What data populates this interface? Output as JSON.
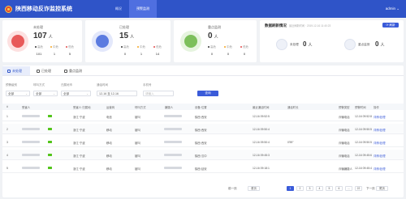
{
  "header": {
    "title": "陕西移动反诈监控系统",
    "tabs": [
      {
        "label": "概况"
      },
      {
        "label": "预警监测"
      }
    ],
    "user": "admin ⌄"
  },
  "stats": [
    {
      "label": "未处理",
      "value": "107",
      "unit": "人",
      "subs": [
        {
          "k": "高危",
          "v": "101",
          "color": "#333333"
        },
        {
          "k": "中危",
          "v": "1",
          "color": "#f5a623"
        },
        {
          "k": "低危",
          "v": "5",
          "color": "#e24c4c"
        }
      ]
    },
    {
      "label": "已处理",
      "value": "15",
      "unit": "人",
      "subs": [
        {
          "k": "高危",
          "v": "0",
          "color": "#333333"
        },
        {
          "k": "中危",
          "v": "1",
          "color": "#f5a623"
        },
        {
          "k": "低危",
          "v": "14",
          "color": "#e24c4c"
        }
      ]
    },
    {
      "label": "重点监测",
      "value": "0",
      "unit": "人",
      "subs": [
        {
          "k": "高危",
          "v": "0",
          "color": "#333333"
        },
        {
          "k": "中危",
          "v": "0",
          "color": "#f5a623"
        },
        {
          "k": "低危",
          "v": "0",
          "color": "#e24c4c"
        }
      ]
    }
  ],
  "panel": {
    "title": "数据刷新情况",
    "subtitle": "最近刷新时间 · 2019-12-16 11:40:23",
    "refresh": "刷新",
    "items": [
      {
        "label": "未处理",
        "value": "0",
        "unit": "人"
      },
      {
        "label": "重点监测",
        "value": "0",
        "unit": "人"
      }
    ]
  },
  "subtabs": [
    {
      "label": "未处理"
    },
    {
      "label": "已处理"
    },
    {
      "label": "重点监测"
    }
  ],
  "filters": {
    "labels": [
      "预警级别",
      "呼叫方式",
      "归属地市",
      "通话时间",
      "手机号"
    ],
    "values": [
      "全部",
      "全部",
      "全部",
      "12-16 至 12-16",
      ""
    ],
    "placeholder": "请输入",
    "search": "查询"
  },
  "table": {
    "headers": [
      "#",
      "受害人",
      "",
      "受害人·归属地",
      "运营商",
      "呼叫方式",
      "嫌疑人",
      "",
      "设备·位置",
      "最近通话时间",
      "通话时长",
      "",
      "预警类型",
      "预警时间",
      "操作"
    ],
    "rows": [
      [
        "1",
        "浙江·宁波",
        "电信",
        "被叫",
        "陕西·西安",
        "12-16 09:52:5",
        "",
        "诈骗电话",
        "12-16 09:52:8",
        "详情|处理"
      ],
      [
        "2",
        "浙江·宁波",
        "移动",
        "被叫",
        "陕西·西安",
        "12-16 09:50:4",
        "",
        "诈骗电话",
        "12-16 09:50:5",
        "详情|处理"
      ],
      [
        "3",
        "浙江·宁波",
        "移动",
        "被叫",
        "陕西·西安",
        "12-16 09:50:4",
        "0'59\"",
        "诈骗电话",
        "12-16 09:50:5",
        "详情|处理"
      ],
      [
        "4",
        "浙江·宁波",
        "移动",
        "被叫",
        "陕西·汉中",
        "12-16 09:45:3",
        "",
        "诈骗电话",
        "12-16 09:45:6",
        "详情|处理"
      ],
      [
        "5",
        "浙江·宁波",
        "移动",
        "被叫",
        "陕西·延安",
        "12-16 09:18:1",
        "",
        "诈骗嫌疑人",
        "12-16 09:45:4",
        "详情|处理"
      ]
    ]
  },
  "pager": {
    "prev": "前一页",
    "first": "首页",
    "pages": [
      "1",
      "2",
      "3",
      "4",
      "5",
      "6",
      "…",
      "22"
    ],
    "next": "下一页",
    "last": "尾页"
  }
}
